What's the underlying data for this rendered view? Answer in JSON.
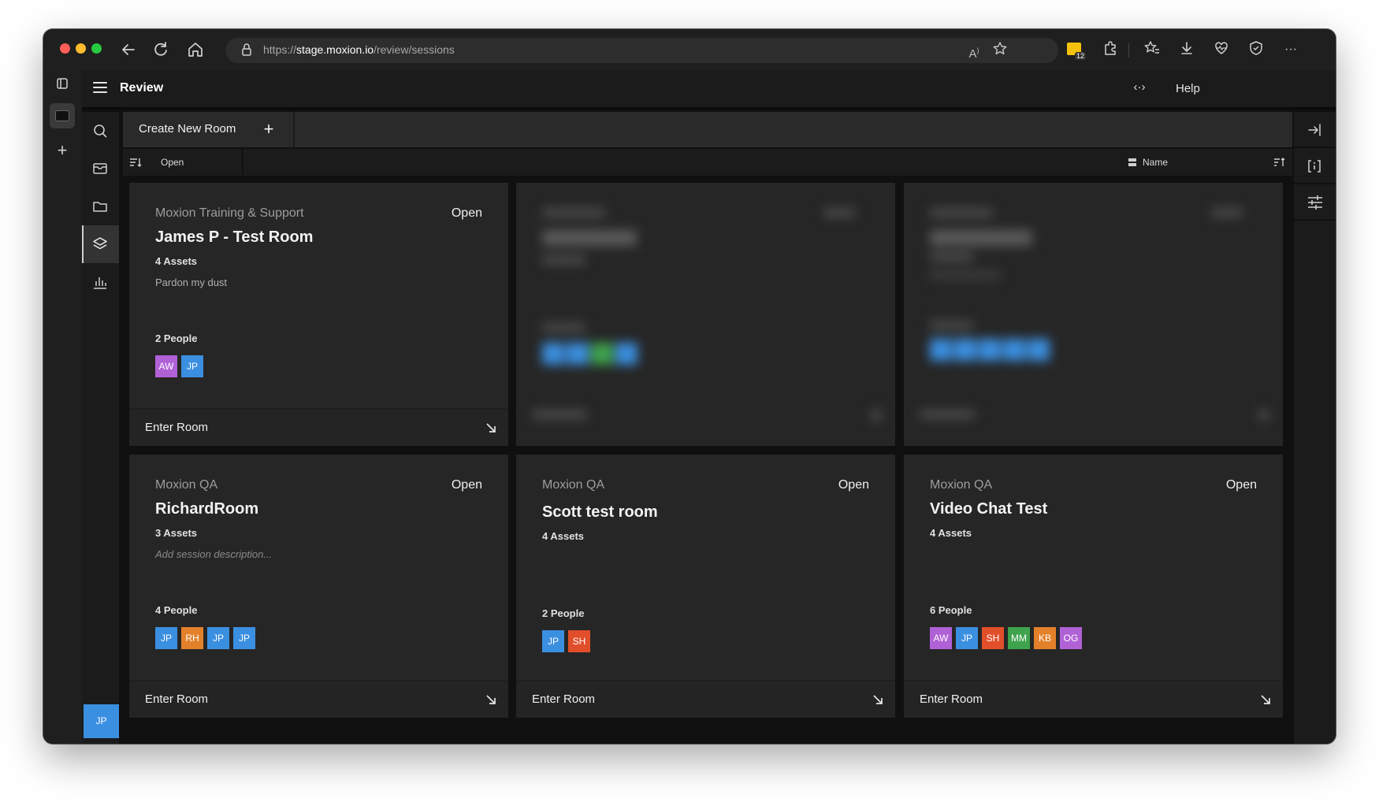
{
  "browser": {
    "url_prefix": "https://",
    "url_host": "stage.moxion.io",
    "url_path": "/review/sessions",
    "ext_badge_count": "12",
    "more_label": "···"
  },
  "app": {
    "title": "Review",
    "help_label": "Help",
    "code_icon": "code-brackets-icon",
    "user_initials": "JP"
  },
  "toolbar": {
    "create_label": "Create New Room",
    "plus_label": "+"
  },
  "filterbar": {
    "filter_value": "Open",
    "sort_value": "Name"
  },
  "cards": [
    {
      "org": "Moxion Training & Support",
      "status": "Open",
      "title": "James P - Test Room",
      "assets": "4 Assets",
      "description": "Pardon my dust",
      "people": "2 People",
      "avatars": [
        {
          "initials": "AW",
          "color": "#b061d6"
        },
        {
          "initials": "JP",
          "color": "#3b8fe0"
        }
      ],
      "enter_label": "Enter Room"
    },
    {
      "org": "Moxion QA",
      "status": "Open",
      "title": "RichardRoom",
      "assets": "3 Assets",
      "description": "Add session description...",
      "people": "4 People",
      "avatars": [
        {
          "initials": "JP",
          "color": "#3b8fe0"
        },
        {
          "initials": "RH",
          "color": "#e3812a"
        },
        {
          "initials": "JP",
          "color": "#3b8fe0"
        },
        {
          "initials": "JP",
          "color": "#3b8fe0"
        }
      ],
      "enter_label": "Enter Room"
    },
    {
      "org": "Moxion QA",
      "status": "Open",
      "title": "Scott test room",
      "assets": "4 Assets",
      "description": "",
      "people": "2 People",
      "avatars": [
        {
          "initials": "JP",
          "color": "#3b8fe0"
        },
        {
          "initials": "SH",
          "color": "#e14f2a"
        }
      ],
      "enter_label": "Enter Room"
    },
    {
      "org": "Moxion QA",
      "status": "Open",
      "title": "Video Chat Test",
      "assets": "4 Assets",
      "description": "",
      "people": "6 People",
      "avatars": [
        {
          "initials": "AW",
          "color": "#b061d6"
        },
        {
          "initials": "JP",
          "color": "#3b8fe0"
        },
        {
          "initials": "SH",
          "color": "#e14f2a"
        },
        {
          "initials": "MM",
          "color": "#3fa34d"
        },
        {
          "initials": "KB",
          "color": "#e3812a"
        },
        {
          "initials": "OG",
          "color": "#b061d6"
        }
      ],
      "enter_label": "Enter Room"
    }
  ],
  "blurred_cards": [
    {
      "avatar_colors": [
        "#3b8fe0",
        "#3b8fe0",
        "#3fa34d",
        "#3b8fe0"
      ]
    },
    {
      "avatar_colors": [
        "#3b8fe0",
        "#3b8fe0",
        "#3b8fe0",
        "#3b8fe0",
        "#3b8fe0"
      ]
    }
  ]
}
